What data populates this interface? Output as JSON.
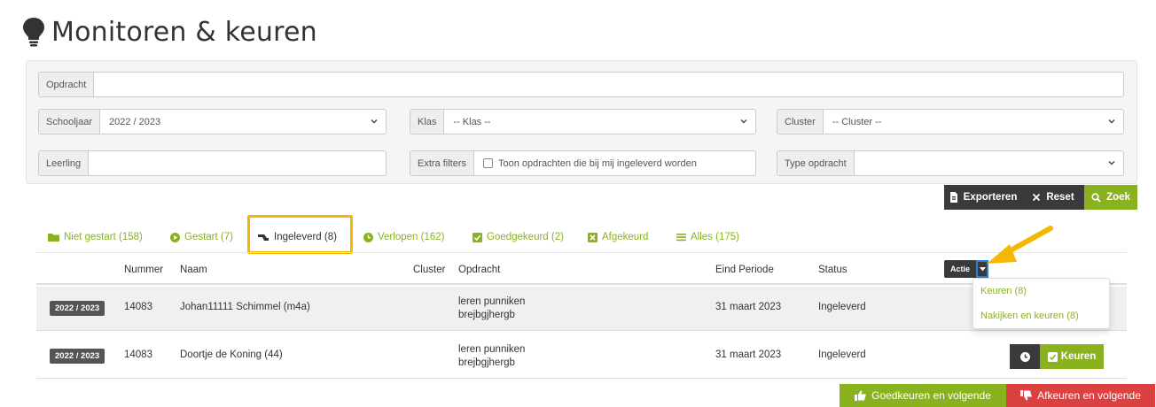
{
  "page": {
    "title": "Monitoren & keuren",
    "icon": "lightbulb-icon"
  },
  "colors": {
    "accent": "#8ab21f",
    "dark": "#3a3a3a",
    "danger": "#dc4141",
    "highlight": "#f5b800"
  },
  "filters": {
    "opdracht": {
      "label": "Opdracht",
      "value": ""
    },
    "schooljaar": {
      "label": "Schooljaar",
      "value": "2022 / 2023"
    },
    "klas": {
      "label": "Klas",
      "value": "-- Klas --"
    },
    "cluster": {
      "label": "Cluster",
      "value": "-- Cluster --"
    },
    "leerling": {
      "label": "Leerling",
      "value": ""
    },
    "extra_filters": {
      "label": "Extra filters",
      "checkbox_label": "Toon opdrachten die bij mij ingeleverd worden",
      "checked": false
    },
    "type_opdracht": {
      "label": "Type opdracht",
      "value": ""
    }
  },
  "toolbar": {
    "export_label": "Exporteren",
    "reset_label": "Reset",
    "search_label": "Zoek"
  },
  "tabs": [
    {
      "label": "Niet gestart (158)",
      "icon": "folder-icon"
    },
    {
      "label": "Gestart (7)",
      "icon": "play-circle-icon"
    },
    {
      "label": "Ingeleverd (8)",
      "icon": "hand-in-icon",
      "active": true
    },
    {
      "label": "Verlopen (162)",
      "icon": "clock-icon"
    },
    {
      "label": "Goedgekeurd (2)",
      "icon": "check-square-icon"
    },
    {
      "label": "Afgekeurd",
      "icon": "x-square-icon"
    },
    {
      "label": "Alles (175)",
      "icon": "list-icon"
    }
  ],
  "table": {
    "columns": [
      "Nummer",
      "Naam",
      "Cluster",
      "Opdracht",
      "Eind Periode",
      "Status"
    ],
    "actie_label": "Actie",
    "rows": [
      {
        "year": "2022 / 2023",
        "nummer": "14083",
        "naam": "Johan11111 Schimmel (m4a)",
        "cluster": "",
        "opdracht_line1": "leren punniken",
        "opdracht_line2": "brejbgjhergb",
        "eind_periode": "31 maart 2023",
        "status": "Ingeleverd"
      },
      {
        "year": "2022 / 2023",
        "nummer": "14083",
        "naam": "Doortje de Koning (44)",
        "cluster": "",
        "opdracht_line1": "leren punniken",
        "opdracht_line2": "brejbgjhergb",
        "eind_periode": "31 maart 2023",
        "status": "Ingeleverd",
        "keuren_label": "Keuren"
      }
    ]
  },
  "actie_menu": {
    "items": [
      "Keuren (8)",
      "Nakijken en keuren (8)"
    ]
  },
  "footer": {
    "approve_label": "Goedkeuren en volgende",
    "reject_label": "Afkeuren en volgende"
  }
}
